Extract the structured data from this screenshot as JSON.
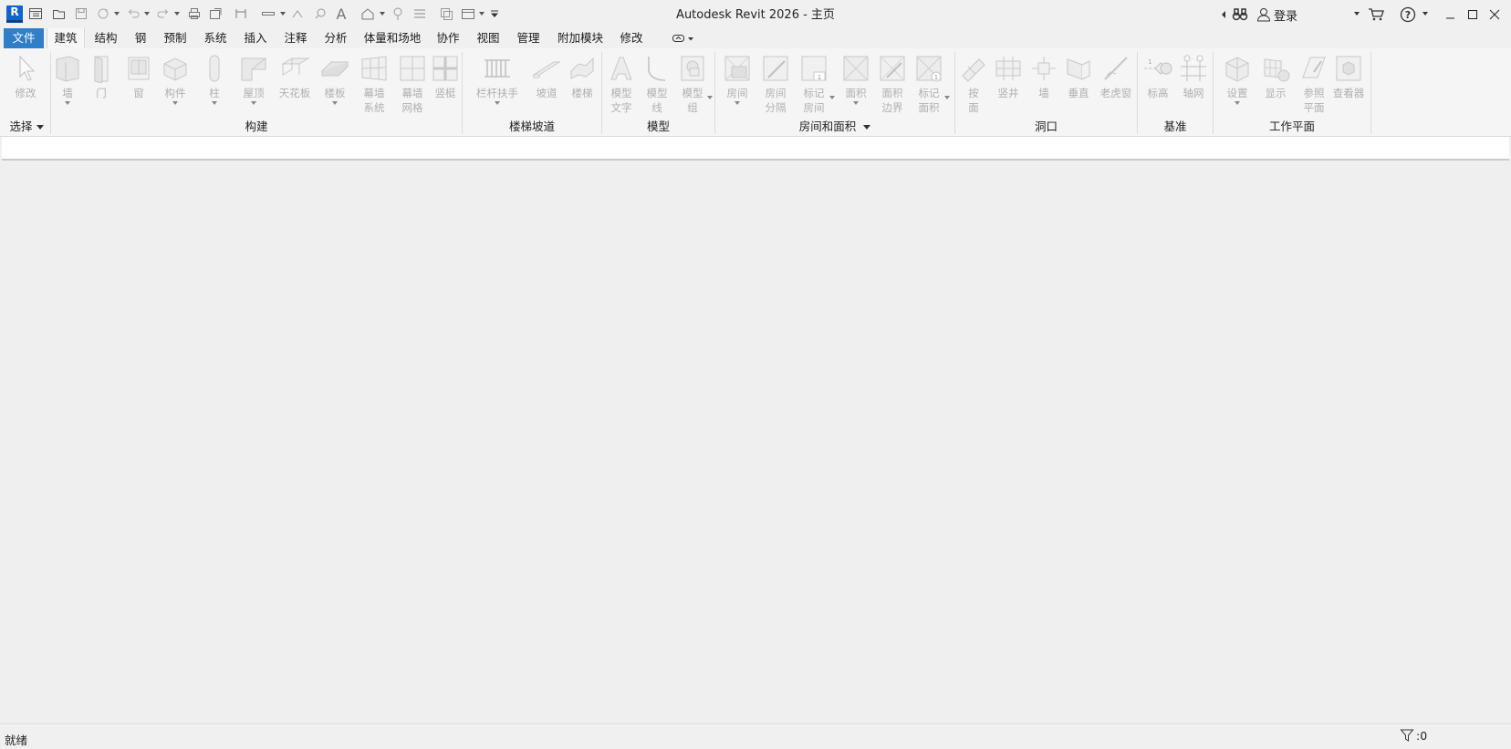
{
  "title_bar": {
    "window_title": "Autodesk Revit 2026 - 主页",
    "logo_letter": "R",
    "sign_in_label": "登录",
    "qat_icons": [
      "home-view-icon",
      "open-icon",
      "save-icon",
      "sync-icon",
      "undo-icon",
      "redo-icon",
      "print-icon",
      "export-icon",
      "measure-icon",
      "dimension-icon",
      "tag-icon",
      "text-icon",
      "3d-view-icon",
      "section-icon",
      "thin-lines-icon",
      "close-hidden-icon",
      "switch-windows-icon",
      "customize-icon"
    ]
  },
  "tabs": [
    "文件",
    "建筑",
    "结构",
    "钢",
    "预制",
    "系统",
    "插入",
    "注释",
    "分析",
    "体量和场地",
    "协作",
    "视图",
    "管理",
    "附加模块",
    "修改"
  ],
  "active_tab": "建筑",
  "ribbon": {
    "select_panel": {
      "title": "选择",
      "tools": [
        {
          "label": "修改",
          "icon": "cursor-arrow-icon"
        }
      ]
    },
    "build_panel": {
      "title": "构建",
      "tools": [
        {
          "label": "墙",
          "icon": "wall-icon"
        },
        {
          "label": "门",
          "icon": "door-icon"
        },
        {
          "label": "窗",
          "icon": "window-icon"
        },
        {
          "label": "构件",
          "icon": "component-icon"
        },
        {
          "label": "柱",
          "icon": "column-icon"
        },
        {
          "label": "屋顶",
          "icon": "roof-icon"
        },
        {
          "label": "天花板",
          "icon": "ceiling-icon"
        },
        {
          "label": "楼板",
          "icon": "floor-icon"
        },
        {
          "label": "幕墙\n系统",
          "icon": "curtain-system-icon"
        },
        {
          "label": "幕墙\n网格",
          "icon": "curtain-grid-icon"
        },
        {
          "label": "竖梃",
          "icon": "mullion-icon"
        }
      ]
    },
    "circulation_panel": {
      "title": "楼梯坡道",
      "tools": [
        {
          "label": "栏杆扶手",
          "icon": "railing-icon"
        },
        {
          "label": "坡道",
          "icon": "ramp-icon"
        },
        {
          "label": "楼梯",
          "icon": "stair-icon"
        }
      ]
    },
    "model_panel": {
      "title": "模型",
      "tools": [
        {
          "label": "模型\n文字",
          "icon": "model-text-icon"
        },
        {
          "label": "模型\n线",
          "icon": "model-line-icon"
        },
        {
          "label": "模型\n组",
          "icon": "model-group-icon"
        }
      ]
    },
    "room_panel": {
      "title": "房间和面积",
      "tools": [
        {
          "label": "房间",
          "icon": "room-icon"
        },
        {
          "label": "房间\n分隔",
          "icon": "room-separator-icon"
        },
        {
          "label": "标记\n房间",
          "icon": "tag-room-icon"
        },
        {
          "label": "面积",
          "icon": "area-icon"
        },
        {
          "label": "面积\n边界",
          "icon": "area-boundary-icon"
        },
        {
          "label": "标记\n面积",
          "icon": "tag-area-icon"
        }
      ]
    },
    "opening_panel": {
      "title": "洞口",
      "tools": [
        {
          "label": "按\n面",
          "icon": "by-face-icon"
        },
        {
          "label": "竖井",
          "icon": "shaft-icon"
        },
        {
          "label": "墙",
          "icon": "wall-opening-icon"
        },
        {
          "label": "垂直",
          "icon": "vertical-opening-icon"
        },
        {
          "label": "老虎窗",
          "icon": "dormer-icon"
        }
      ]
    },
    "datum_panel": {
      "title": "基准",
      "tools": [
        {
          "label": "标高",
          "icon": "level-icon"
        },
        {
          "label": "轴网",
          "icon": "grid-icon"
        }
      ]
    },
    "workplane_panel": {
      "title": "工作平面",
      "tools": [
        {
          "label": "设置",
          "icon": "set-workplane-icon"
        },
        {
          "label": "显示",
          "icon": "show-workplane-icon"
        },
        {
          "label": "参照\n平面",
          "icon": "ref-plane-icon"
        },
        {
          "label": "查看器",
          "icon": "viewer-icon"
        }
      ]
    }
  },
  "status_bar": {
    "status_text": "就绪",
    "filter_count": ":0"
  }
}
